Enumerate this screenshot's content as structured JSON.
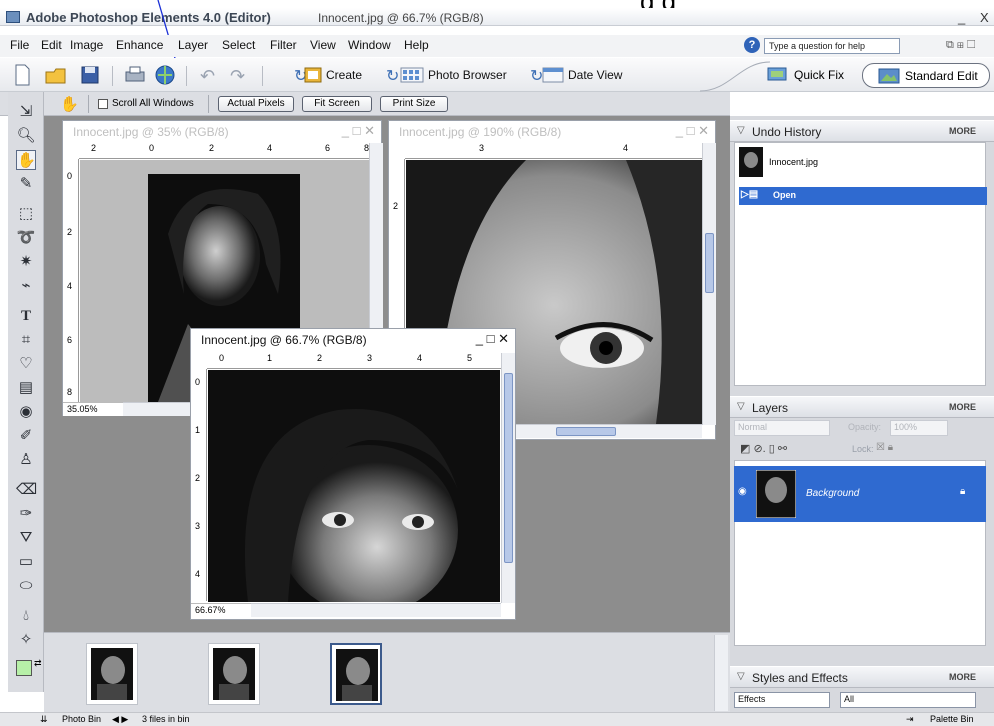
{
  "window": {
    "title": "Adobe Photoshop Elements 4.0 (Editor)",
    "document": "Innocent.jpg @ 66.7% (RGB/8)",
    "ctrl_min": "_",
    "ctrl_max": "□",
    "ctrl_close": "X"
  },
  "annotation": {
    "text": "g        g"
  },
  "menu": {
    "items": [
      "File",
      "Edit",
      "Image",
      "Enhance",
      "Layer",
      "Select",
      "Filter",
      "View",
      "Window",
      "Help"
    ],
    "help_placeholder": "Type a question for help"
  },
  "toolbar": {
    "create_label": "Create",
    "photo_browser_label": "Photo Browser",
    "date_view_label": "Date View",
    "quick_fix_label": "Quick Fix",
    "standard_edit_label": "Standard Edit"
  },
  "options": {
    "scroll_all_label": "Scroll All Windows",
    "actual_pixels_label": "Actual Pixels",
    "fit_screen_label": "Fit Screen",
    "print_size_label": "Print Size"
  },
  "docs": {
    "doc1": {
      "title": "Innocent.jpg @ 35% (RGB/8)",
      "zoom": "35.05%"
    },
    "doc2": {
      "title": "Innocent.jpg @ 190% (RGB/8)"
    },
    "doc3": {
      "title": "Innocent.jpg @ 66.7% (RGB/8)",
      "zoom": "66.67%"
    }
  },
  "rulers": {
    "doc1_h": [
      "2",
      "0",
      "2",
      "4",
      "6",
      "8"
    ],
    "doc1_v": [
      "0",
      "2",
      "4",
      "6",
      "8"
    ],
    "doc2_h": [
      "3",
      "4"
    ],
    "doc2_v": [
      "2"
    ],
    "doc3_h": [
      "0",
      "1",
      "2",
      "3",
      "4",
      "5"
    ],
    "doc3_v": [
      "0",
      "1",
      "2",
      "3",
      "4"
    ]
  },
  "undo_history": {
    "title": "Undo History",
    "more": "MORE",
    "snapshot": "Innocent.jpg",
    "step": "Open"
  },
  "layers": {
    "title": "Layers",
    "more": "MORE",
    "blend_mode": "Normal",
    "opacity_label": "Opacity:",
    "opacity_value": "100%",
    "lock_label": "Lock:",
    "layer_name": "Background"
  },
  "styles": {
    "title": "Styles and Effects",
    "more": "MORE",
    "category": "Effects",
    "filter": "All"
  },
  "statusbar": {
    "photo_bin_label": "Photo Bin",
    "files_count": "3 files in bin",
    "palette_bin_label": "Palette Bin"
  },
  "colors": {
    "selection_blue": "#2f6ad0",
    "foreground_swatch": "#b7f0a8",
    "background_swatch": "#ffffff"
  }
}
